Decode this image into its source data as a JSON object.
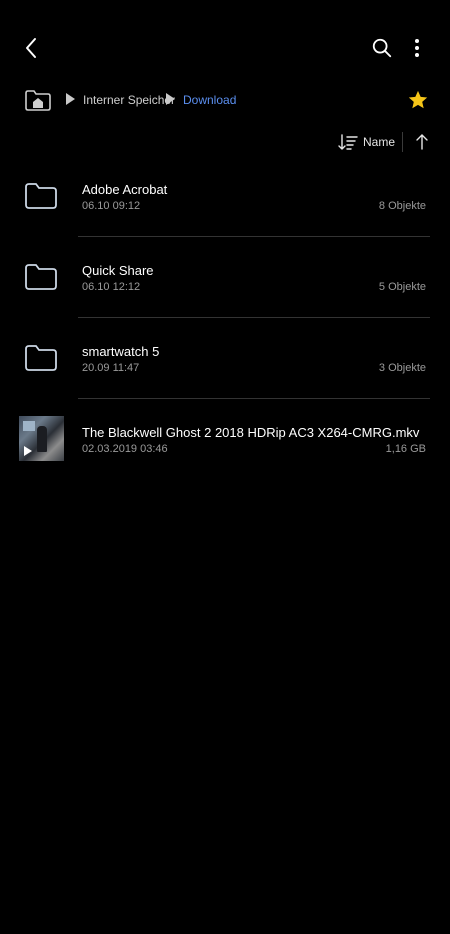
{
  "topbar": {
    "back_icon": "chevron-left-icon",
    "search_icon": "search-icon",
    "more_icon": "more-vertical-icon"
  },
  "breadcrumb": {
    "home_icon": "home-folder-icon",
    "items": [
      {
        "label": "Interner Speicher"
      },
      {
        "label": "Download"
      }
    ],
    "favorite_icon": "star-icon",
    "favorite_color": "#f5c518",
    "current_color": "#5b8ff0"
  },
  "sort": {
    "icon": "sort-icon",
    "label": "Name",
    "order_icon": "arrow-up-icon"
  },
  "files": [
    {
      "type": "folder",
      "name": "Adobe Acrobat",
      "date": "06.10 09:12",
      "meta": "8 Objekte"
    },
    {
      "type": "folder",
      "name": "Quick Share",
      "date": "06.10 12:12",
      "meta": "5 Objekte"
    },
    {
      "type": "folder",
      "name": "smartwatch 5",
      "date": "20.09 11:47",
      "meta": "3 Objekte"
    },
    {
      "type": "video",
      "name": "The Blackwell Ghost 2 2018 HDRip AC3 X264-CMRG.mkv",
      "date": "02.03.2019 03:46",
      "meta": "1,16 GB"
    }
  ]
}
